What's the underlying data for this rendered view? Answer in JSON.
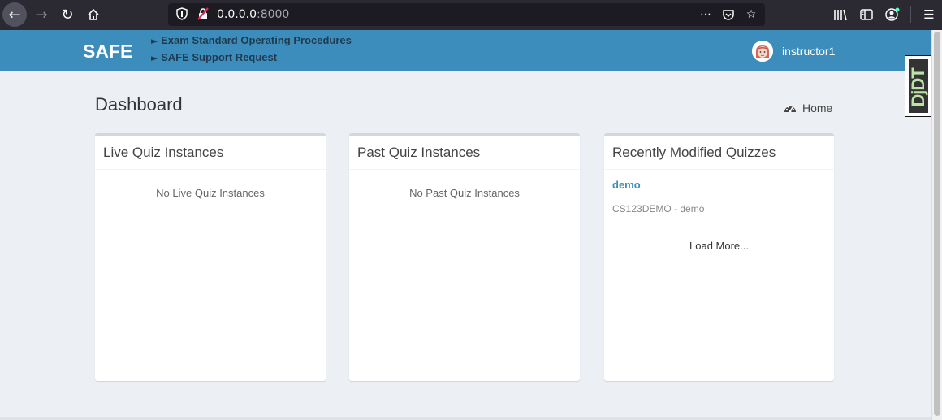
{
  "browser": {
    "url_host": "0.0.0.0",
    "url_port": ":8000"
  },
  "header": {
    "logo": "SAFE",
    "links": [
      {
        "label": "Exam Standard Operating Procedures"
      },
      {
        "label": "SAFE Support Request"
      }
    ],
    "link_arrow": "►",
    "user_name": "instructor1"
  },
  "djdt": {
    "label": "DjDT"
  },
  "page": {
    "title": "Dashboard",
    "breadcrumb_label": "Home"
  },
  "boxes": {
    "live": {
      "title": "Live Quiz Instances",
      "empty": "No Live Quiz Instances"
    },
    "past": {
      "title": "Past Quiz Instances",
      "empty": "No Past Quiz Instances"
    },
    "recent": {
      "title": "Recently Modified Quizzes",
      "items": [
        {
          "name": "demo",
          "subtitle": "CS123DEMO - demo"
        }
      ],
      "load_more": "Load More..."
    }
  },
  "colors": {
    "header_bg": "#3c8dbc",
    "page_bg": "#ecf0f5",
    "link": "#3c8dbc"
  }
}
